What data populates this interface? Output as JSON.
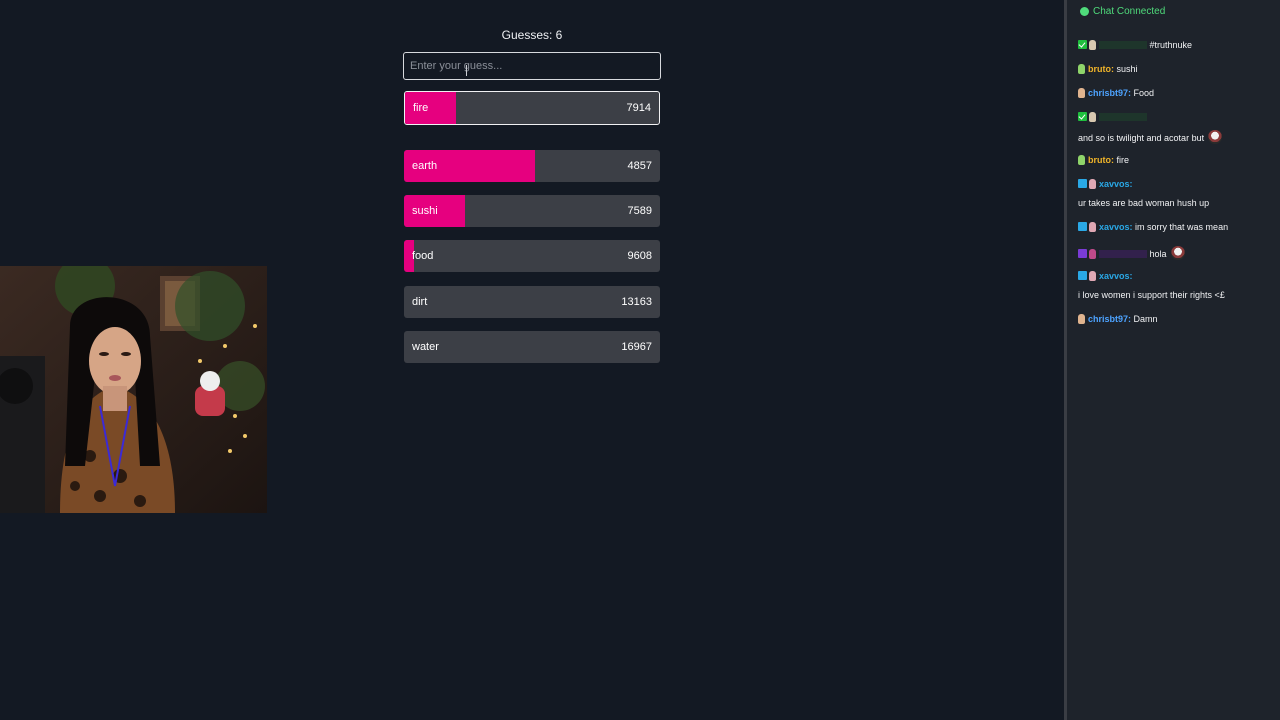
{
  "game": {
    "guess_count_label": "Guesses: 6",
    "input_placeholder": "Enter your guess...",
    "current_guess": {
      "word": "fire",
      "rank": "7914",
      "fill": 0.2
    },
    "guesses": [
      {
        "word": "earth",
        "rank": "4857",
        "fill": 0.51
      },
      {
        "word": "sushi",
        "rank": "7589",
        "fill": 0.24
      },
      {
        "word": "food",
        "rank": "9608",
        "fill": 0.04
      },
      {
        "word": "dirt",
        "rank": "13163",
        "fill": 0
      },
      {
        "word": "water",
        "rank": "16967",
        "fill": 0
      }
    ],
    "accent_color": "#e6007f"
  },
  "chat": {
    "status": "Chat Connected",
    "messages": [
      {
        "user": "",
        "user_color": "#1f5a2a",
        "text": "#truthnuke",
        "badges": [
          "check"
        ],
        "hand": "#d8c8b0"
      },
      {
        "user": "bruto:",
        "user_color": "#f0b429",
        "text": "sushi",
        "badges": [],
        "hand": "#8fd46a"
      },
      {
        "user": "chrisbt97:",
        "user_color": "#4da3ff",
        "text": "Food",
        "badges": [],
        "hand": "#e0b48f"
      },
      {
        "user": "",
        "user_color": "#1f5a2a",
        "text": "",
        "badges": [
          "check"
        ],
        "hand": "#d8c8b0"
      },
      {
        "user": "",
        "user_color": "",
        "text": "and so is twilight and acotar but",
        "badges": [],
        "hand": "",
        "emote": true
      },
      {
        "user": "bruto:",
        "user_color": "#f0b429",
        "text": "fire",
        "badges": [],
        "hand": "#8fd46a"
      },
      {
        "user": "xavvos:",
        "user_color": "#2aa8e6",
        "text": "",
        "badges": [
          "prime"
        ],
        "hand": "#e0a8b4"
      },
      {
        "user": "",
        "user_color": "",
        "text": "ur takes are bad woman hush up",
        "badges": [],
        "hand": ""
      },
      {
        "user": "xavvos:",
        "user_color": "#2aa8e6",
        "text": "im sorry that was mean",
        "badges": [
          "prime"
        ],
        "hand": "#e0a8b4"
      },
      {
        "user": "",
        "user_color": "#5a1f8a",
        "text": "hola",
        "badges": [
          "sub"
        ],
        "hand": "#c04a8a",
        "emote": true
      },
      {
        "user": "xavvos:",
        "user_color": "#2aa8e6",
        "text": "",
        "badges": [
          "prime"
        ],
        "hand": "#e0a8b4"
      },
      {
        "user": "",
        "user_color": "",
        "text": "i love women i support their rights <£",
        "badges": [],
        "hand": ""
      },
      {
        "user": "chrisbt97:",
        "user_color": "#4da3ff",
        "text": "Damn",
        "badges": [],
        "hand": "#e0b48f"
      }
    ]
  }
}
